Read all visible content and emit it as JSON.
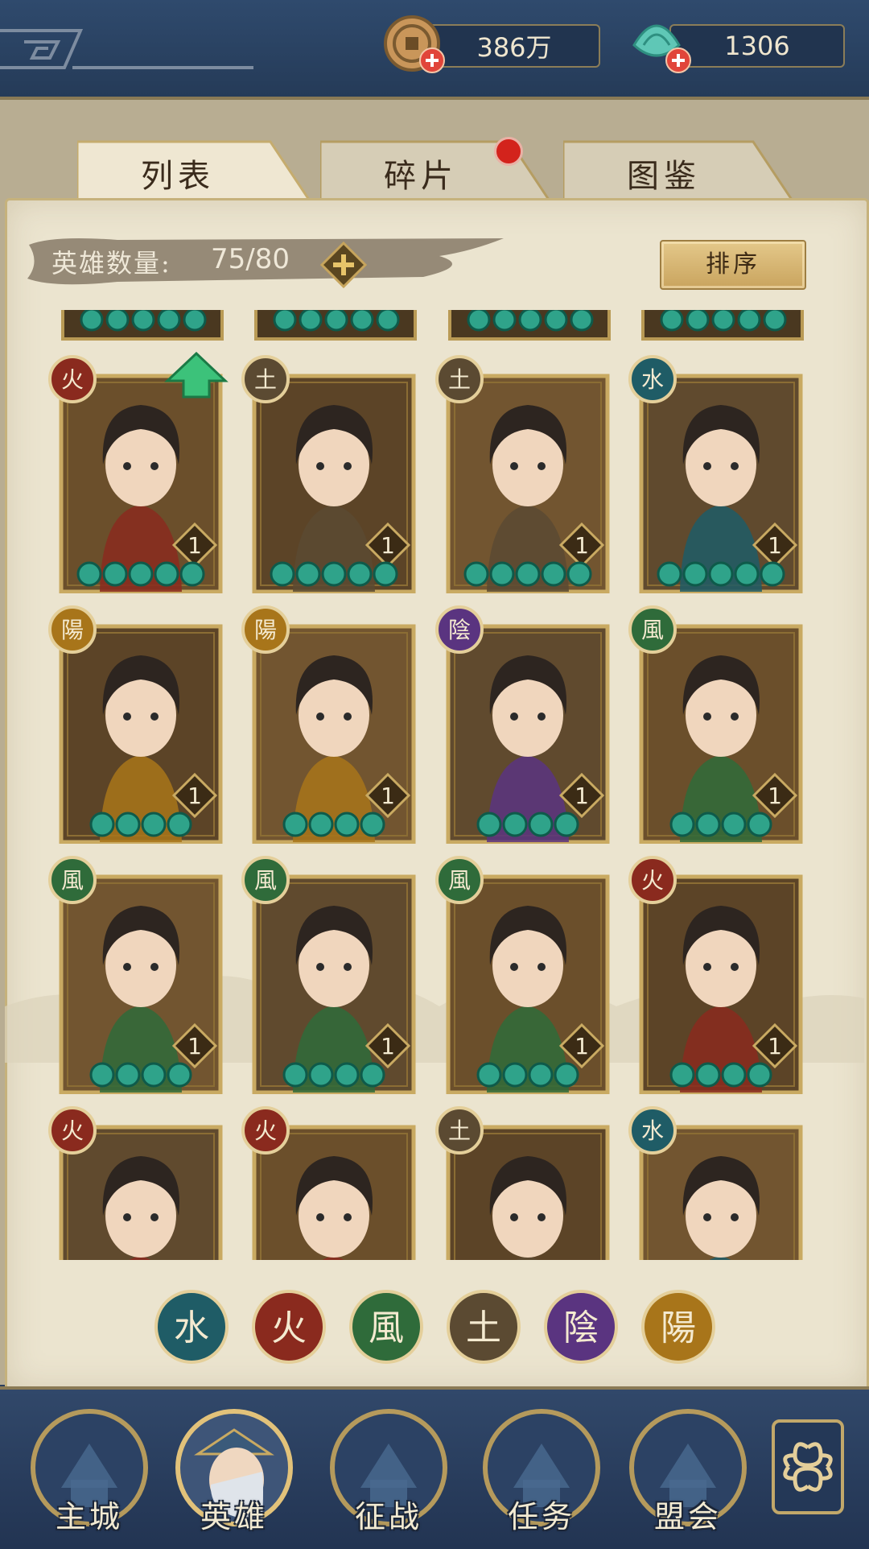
{
  "resources": {
    "coins": "386万",
    "jade": "1306"
  },
  "tabs": [
    {
      "label": "列表",
      "active": true
    },
    {
      "label": "碎片",
      "active": false,
      "badge": true
    },
    {
      "label": "图鉴",
      "active": false
    }
  ],
  "hero_panel": {
    "count_label": "英雄数量:",
    "count_value": "75/80",
    "sort_label": "排序"
  },
  "heroes": [
    {
      "element": "火",
      "element_icon": "fire-icon",
      "level": "1",
      "stars": 5,
      "upgrade_arrow": true
    },
    {
      "element": "土",
      "element_icon": "earth-icon",
      "level": "1",
      "stars": 5
    },
    {
      "element": "土",
      "element_icon": "earth-icon",
      "level": "1",
      "stars": 5
    },
    {
      "element": "水",
      "element_icon": "water-icon",
      "level": "1",
      "stars": 5
    },
    {
      "element": "陽",
      "element_icon": "yang-icon",
      "level": "1",
      "stars": 4
    },
    {
      "element": "陽",
      "element_icon": "yang-icon",
      "level": "1",
      "stars": 4
    },
    {
      "element": "陰",
      "element_icon": "yin-icon",
      "level": "1",
      "stars": 4
    },
    {
      "element": "風",
      "element_icon": "wind-icon",
      "level": "1",
      "stars": 4
    },
    {
      "element": "風",
      "element_icon": "wind-icon",
      "level": "1",
      "stars": 4
    },
    {
      "element": "風",
      "element_icon": "wind-icon",
      "level": "1",
      "stars": 4
    },
    {
      "element": "風",
      "element_icon": "wind-icon",
      "level": "1",
      "stars": 4
    },
    {
      "element": "火",
      "element_icon": "fire-icon",
      "level": "1",
      "stars": 4
    },
    {
      "element": "火",
      "element_icon": "fire-icon"
    },
    {
      "element": "火",
      "element_icon": "fire-icon"
    },
    {
      "element": "土",
      "element_icon": "earth-icon"
    },
    {
      "element": "水",
      "element_icon": "water-icon"
    }
  ],
  "element_filters": [
    {
      "glyph": "水",
      "icon": "water-icon",
      "color": "#1f5c66"
    },
    {
      "glyph": "火",
      "icon": "fire-icon",
      "color": "#8a2a1e"
    },
    {
      "glyph": "風",
      "icon": "wind-icon",
      "color": "#2f6b3a"
    },
    {
      "glyph": "土",
      "icon": "earth-icon",
      "color": "#5b4a32"
    },
    {
      "glyph": "陰",
      "icon": "yin-icon",
      "color": "#5a3480"
    },
    {
      "glyph": "陽",
      "icon": "yang-icon",
      "color": "#a8751a"
    }
  ],
  "element_colors": {
    "火": "#8a2a1e",
    "土": "#5b4a32",
    "水": "#1f5c66",
    "陽": "#a8751a",
    "陰": "#5a3480",
    "風": "#2f6b3a"
  },
  "nav": [
    {
      "label": "主城",
      "icon": "main-city-icon",
      "active": false
    },
    {
      "label": "英雄",
      "icon": "hero-icon",
      "active": true
    },
    {
      "label": "征战",
      "icon": "campaign-icon",
      "active": false
    },
    {
      "label": "任务",
      "icon": "quest-icon",
      "active": false
    },
    {
      "label": "盟会",
      "icon": "guild-icon",
      "active": false
    }
  ]
}
